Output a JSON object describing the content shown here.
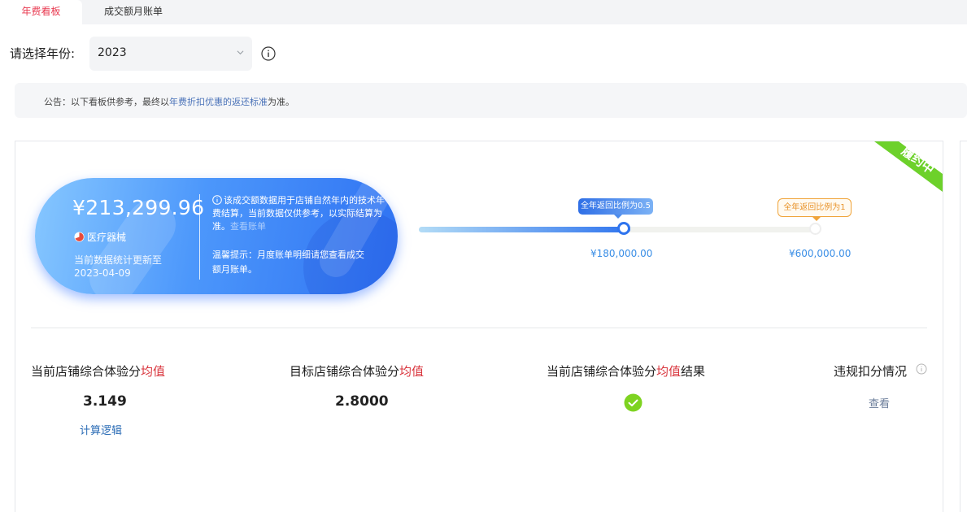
{
  "tabs": [
    {
      "label": "年费看板",
      "active": true
    },
    {
      "label": "成交额月账单",
      "active": false
    }
  ],
  "year_selector": {
    "label": "请选择年份:",
    "value": "2023"
  },
  "notice": {
    "prefix": "公告：以下看板供参考，最终以",
    "link": "年费折扣优惠的返还标准",
    "suffix": "为准。"
  },
  "status_ribbon": "履约中",
  "summary": {
    "amount": "¥213,299.96",
    "category": "医疗器械",
    "update_line1": "当前数据统计更新至",
    "update_date": "2023-04-09",
    "info_text": "该成交额数据用于店铺自然年内的技术年费结算，当前数据仅供参考，以实际结算为准。",
    "info_link": "查看账单",
    "tip_text": "温馨提示：月度账单明细请您查看成交额月账单。"
  },
  "progress": {
    "current_fraction": 0.5,
    "milestones": [
      {
        "label": "全年返回比例为0.5",
        "value": "¥180,000.00",
        "color": "#2f74ee"
      },
      {
        "label": "全年返回比例为1",
        "value": "¥600,000.00",
        "color": "#e8932a"
      }
    ]
  },
  "metrics": {
    "current_score": {
      "title_prefix": "当前店铺综合体验分",
      "title_red": "均值",
      "value": "3.149",
      "link": "计算逻辑"
    },
    "target_score": {
      "title_prefix": "目标店铺综合体验分",
      "title_red": "均值",
      "value": "2.8000"
    },
    "result": {
      "title_prefix": "当前店铺综合体验分",
      "title_red": "均值",
      "title_suffix": "结果",
      "status": "passed"
    },
    "violations": {
      "title": "违规扣分情况",
      "link": "查看"
    }
  },
  "colors": {
    "accent_red": "#d9363e",
    "link_blue": "#2c6db6",
    "success_green": "#7ed321",
    "ribbon_green": "#6dd12b"
  }
}
